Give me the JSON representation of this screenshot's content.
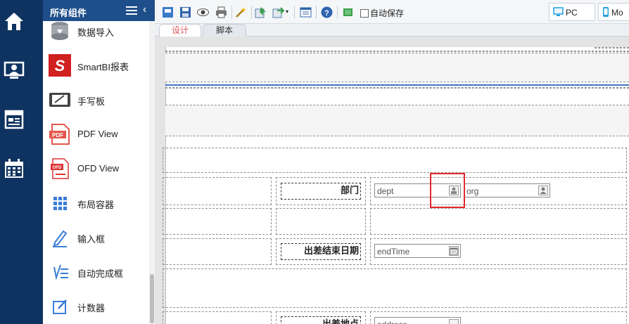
{
  "rail": {
    "icons": [
      "home-icon",
      "user-monitor-icon",
      "report-icon",
      "calendar-icon"
    ]
  },
  "panel": {
    "title": "所有组件",
    "items": [
      {
        "label": "数据导入",
        "icon": "database-import-icon"
      },
      {
        "label": "SmartBI报表",
        "icon": "smartbi-icon"
      },
      {
        "label": "手写板",
        "icon": "handwriting-pad-icon"
      },
      {
        "label": "PDF View",
        "icon": "pdf-icon"
      },
      {
        "label": "OFD View",
        "icon": "ofd-icon"
      },
      {
        "label": "布局容器",
        "icon": "layout-grid-icon"
      },
      {
        "label": "输入框",
        "icon": "pencil-icon"
      },
      {
        "label": "自动完成框",
        "icon": "autocomplete-icon"
      },
      {
        "label": "计数器",
        "icon": "edit-box-icon"
      }
    ]
  },
  "toolbar": {
    "autosave_label": "自动保存",
    "mode_pc": "PC",
    "mode_mobile": "Mo"
  },
  "tabs": {
    "design": "设计",
    "script": "脚本"
  },
  "form": {
    "dept_label": "部门",
    "dept_value": "dept",
    "org_value": "org",
    "end_label": "出差结束日期",
    "end_value": "endTime",
    "addr_label": "出差地点",
    "addr_value": "address"
  },
  "colors": {
    "rail": "#0f3360",
    "panel_header": "#1f4f8a",
    "active_tab": "#d85555",
    "highlight": "#e5282a"
  }
}
